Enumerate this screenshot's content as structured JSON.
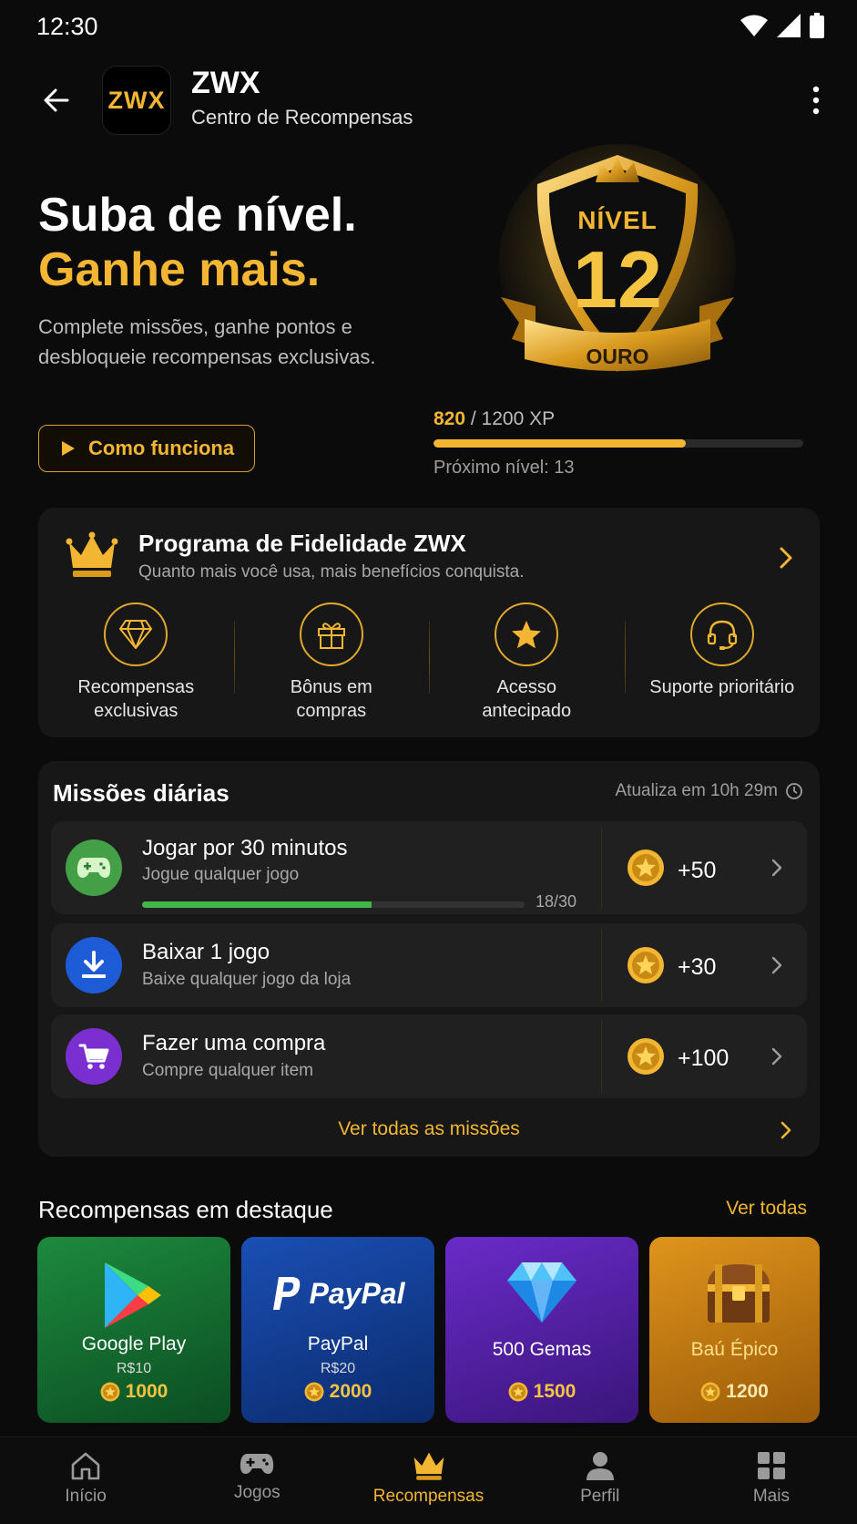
{
  "status_bar": {
    "time": "12:30"
  },
  "header": {
    "logo_text": "ZWX",
    "app_name": "ZWX",
    "subtitle": "Centro de Recompensas"
  },
  "hero": {
    "title_line1": "Suba de nível.",
    "title_line2": "Ganhe mais.",
    "description": "Complete missões, ganhe pontos e desbloqueie recompensas exclusivas.",
    "how_button": "Como funciona"
  },
  "level": {
    "label": "NÍVEL",
    "number": "12",
    "tier": "OURO",
    "xp_current": "820",
    "xp_total": "/ 1200 XP",
    "xp_progress": 0.683,
    "next_level": "Próximo nível: 13"
  },
  "loyalty": {
    "title": "Programa de Fidelidade ZWX",
    "subtitle": "Quanto mais você usa, mais benefícios conquista.",
    "benefits": [
      {
        "label": "Recompensas exclusivas",
        "icon": "diamond-icon"
      },
      {
        "label": "Bônus em compras",
        "icon": "gift-icon"
      },
      {
        "label": "Acesso antecipado",
        "icon": "star-icon"
      },
      {
        "label": "Suporte prioritário",
        "icon": "headset-icon"
      }
    ]
  },
  "missions": {
    "title": "Missões diárias",
    "refresh": "Atualiza em 10h 29m",
    "items": [
      {
        "title": "Jogar por 30 minutos",
        "subtitle": "Jogue qualquer jogo",
        "reward": "+50",
        "progress_text": "18/30",
        "progress": 0.6,
        "icon": "gamepad-icon",
        "color": "#43a047"
      },
      {
        "title": "Baixar 1 jogo",
        "subtitle": "Baixe qualquer jogo da loja",
        "reward": "+30",
        "icon": "download-icon",
        "color": "#1e5bd6"
      },
      {
        "title": "Fazer uma compra",
        "subtitle": "Compre qualquer item",
        "reward": "+100",
        "icon": "cart-icon",
        "color": "#7b2fd0"
      }
    ],
    "see_all": "Ver todas as missões"
  },
  "featured": {
    "title": "Recompensas em destaque",
    "see_all": "Ver todas",
    "items": [
      {
        "name": "Google Play",
        "price": "R$10",
        "cost": "1000",
        "icon": "google-play-icon"
      },
      {
        "name": "PayPal",
        "logo_text": "PayPal",
        "price": "R$20",
        "cost": "2000",
        "icon": "paypal-icon"
      },
      {
        "name": "500 Gemas",
        "cost": "1500",
        "icon": "gem-icon"
      },
      {
        "name": "Baú Épico",
        "cost": "1200",
        "icon": "chest-icon"
      }
    ]
  },
  "nav": {
    "items": [
      {
        "label": "Início",
        "icon": "home-icon"
      },
      {
        "label": "Jogos",
        "icon": "gamepad-icon"
      },
      {
        "label": "Recompensas",
        "icon": "crown-icon",
        "active": true
      },
      {
        "label": "Perfil",
        "icon": "person-icon"
      },
      {
        "label": "Mais",
        "icon": "grid-icon"
      }
    ]
  },
  "colors": {
    "accent": "#f2b632",
    "background": "#0b0b0b",
    "card": "#171717",
    "progress_green": "#3fb54a"
  }
}
